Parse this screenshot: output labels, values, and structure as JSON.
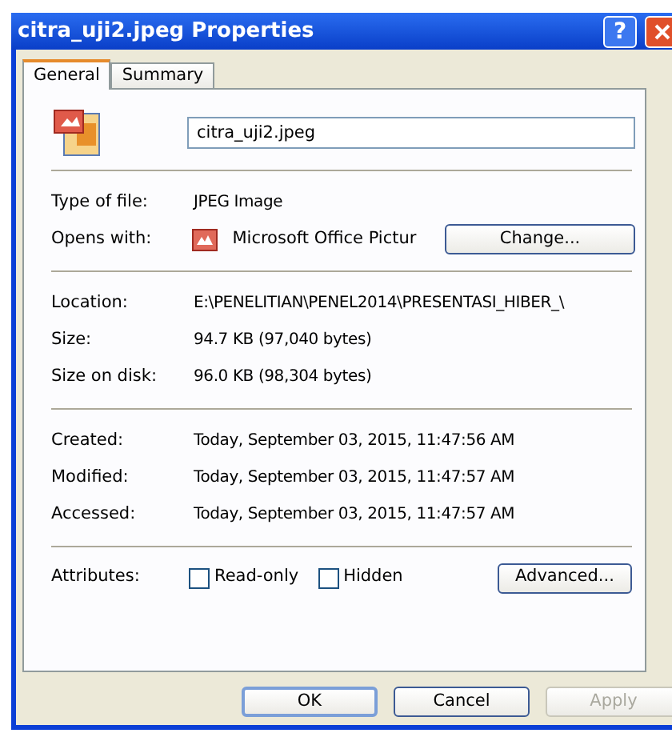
{
  "window": {
    "title": "citra_uji2.jpeg Properties",
    "help_button": "?"
  },
  "tabs": [
    {
      "label": "General",
      "selected": true
    },
    {
      "label": "Summary",
      "selected": false
    }
  ],
  "file_name": {
    "value": "citra_uji2.jpeg"
  },
  "groups": [
    [
      {
        "kind": "text",
        "label": "Type of file:",
        "value": "JPEG Image"
      },
      {
        "kind": "app",
        "label": "Opens with:",
        "value": "Microsoft Office Pictur",
        "button": "Change..."
      }
    ],
    [
      {
        "kind": "text",
        "label": "Location:",
        "value": "E:\\PENELITIAN\\PENEL2014\\PRESENTASI_HIBER_\\"
      },
      {
        "kind": "text",
        "label": "Size:",
        "value": "94.7 KB (97,040 bytes)"
      },
      {
        "kind": "text",
        "label": "Size on disk:",
        "value": "96.0 KB (98,304 bytes)"
      }
    ],
    [
      {
        "kind": "text",
        "label": "Created:",
        "value": "Today, September 03, 2015, 11:47:56 AM"
      },
      {
        "kind": "text",
        "label": "Modified:",
        "value": "Today, September 03, 2015, 11:47:57 AM"
      },
      {
        "kind": "text",
        "label": "Accessed:",
        "value": "Today, September 03, 2015, 11:47:57 AM"
      }
    ]
  ],
  "attributes": {
    "label": "Attributes:",
    "options": [
      {
        "label": "Read-only",
        "checked": false
      },
      {
        "label": "Hidden",
        "checked": false
      }
    ],
    "button": "Advanced..."
  },
  "buttons": [
    {
      "label": "OK",
      "default": true,
      "disabled": false
    },
    {
      "label": "Cancel",
      "default": false,
      "disabled": false
    },
    {
      "label": "Apply",
      "default": false,
      "disabled": true
    }
  ]
}
